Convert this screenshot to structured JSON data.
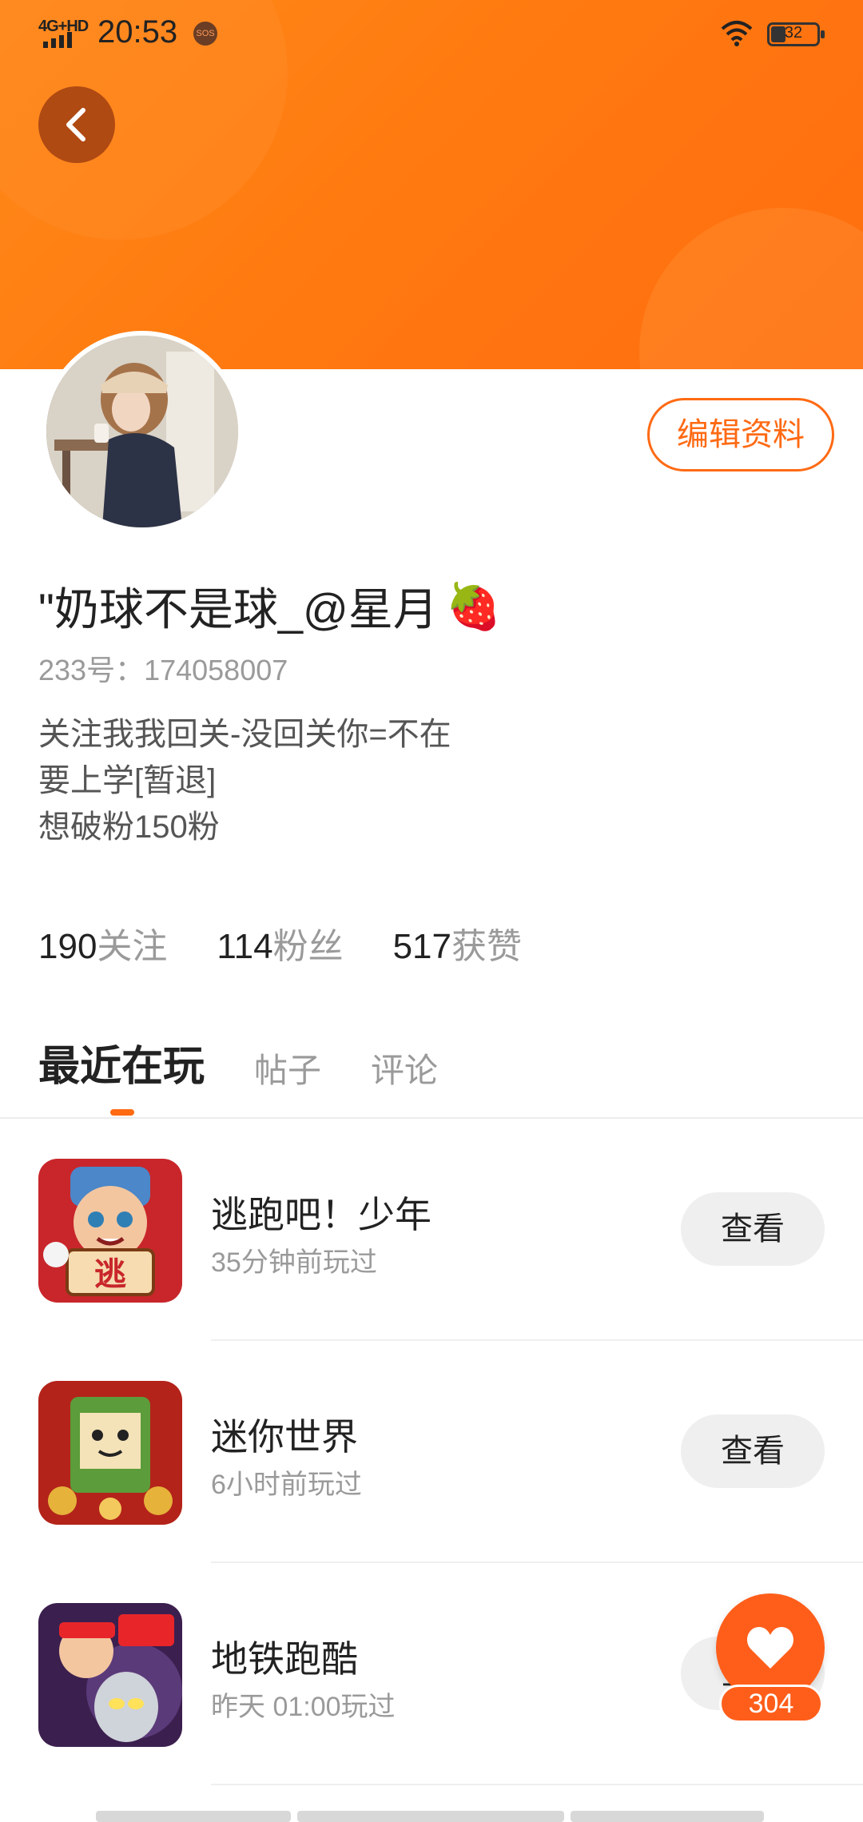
{
  "status_bar": {
    "network": "4G+HD",
    "time": "20:53",
    "sos": "SOS",
    "battery": "32"
  },
  "profile": {
    "edit_label": "编辑资料",
    "nickname": "\"奶球不是球_@星月",
    "nickname_emoji": "🍓",
    "user_id": "233号：174058007",
    "bio": [
      "关注我我回关-没回关你=不在",
      "要上学[暂退]",
      "想破粉150粉"
    ]
  },
  "stats": [
    {
      "value": "190",
      "label": "关注"
    },
    {
      "value": "114",
      "label": "粉丝"
    },
    {
      "value": "517",
      "label": "获赞"
    }
  ],
  "tabs": [
    {
      "label": "最近在玩",
      "active": true
    },
    {
      "label": "帖子",
      "active": false
    },
    {
      "label": "评论",
      "active": false
    }
  ],
  "games": [
    {
      "name": "逃跑吧！少年",
      "last_played": "35分钟前玩过",
      "action": "查看",
      "icon": "game-icon-escape"
    },
    {
      "name": "迷你世界",
      "last_played": "6小时前玩过",
      "action": "查看",
      "icon": "game-icon-mini-world"
    },
    {
      "name": "地铁跑酷",
      "last_played": "昨天 01:00玩过",
      "action": "查看",
      "icon": "game-icon-subway"
    }
  ],
  "like_button": {
    "count": "304"
  },
  "colors": {
    "brand": "#ff6a13",
    "header": "#ff7a10"
  }
}
